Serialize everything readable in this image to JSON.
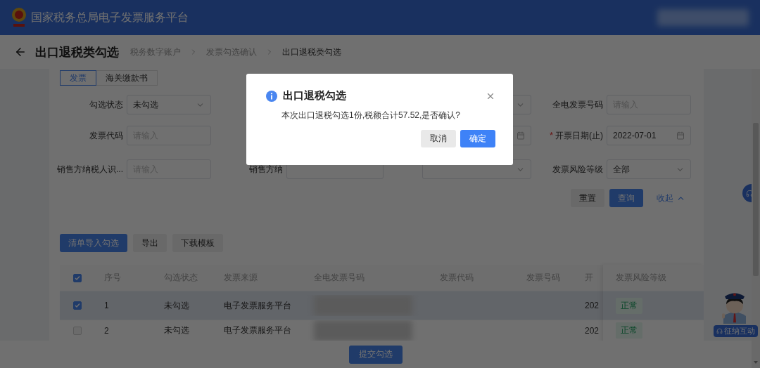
{
  "header": {
    "title": "国家税务总局电子发票服务平台"
  },
  "page": {
    "title": "出口退税类勾选",
    "breadcrumb": [
      {
        "label": "税务数字账户",
        "current": false
      },
      {
        "label": "发票勾选确认",
        "current": false
      },
      {
        "label": "出口退税类勾选",
        "current": true
      }
    ]
  },
  "tabs": [
    {
      "label": "发票",
      "selected": true
    },
    {
      "label": "海关缴款书",
      "selected": false
    }
  ],
  "filter_rows": [
    [
      {
        "kind": "select",
        "label": "勾选状态",
        "value": "未勾选"
      },
      {
        "kind": "blank"
      },
      {
        "kind": "select"
      },
      {
        "kind": "input",
        "label": "全电发票号码",
        "placeholder": "请输入"
      }
    ],
    [
      {
        "kind": "input",
        "label": "发票代码",
        "placeholder": "请输入"
      },
      {
        "kind": "blank"
      },
      {
        "kind": "date"
      },
      {
        "kind": "date",
        "label": "开票日期(止)",
        "required_mark": "*",
        "value": "2022-07-01"
      }
    ],
    [
      {
        "kind": "input",
        "label": "销售方纳税人识...",
        "placeholder": "请输入"
      },
      {
        "kind": "input",
        "label": "销售方纳"
      },
      {
        "kind": "select"
      },
      {
        "kind": "select",
        "label": "发票风险等级",
        "value": "全部"
      }
    ]
  ],
  "filter_actions": [
    {
      "label": "重置",
      "kind": "default"
    },
    {
      "label": "查询",
      "kind": "primary"
    },
    {
      "label": "收起",
      "kind": "link"
    }
  ],
  "toolbar": [
    {
      "label": "清单导入勾选",
      "kind": "primary"
    },
    {
      "label": "导出",
      "kind": "default"
    },
    {
      "label": "下载模板",
      "kind": "default"
    }
  ],
  "table": {
    "all_checked": true,
    "columns": [
      "序号",
      "勾选状态",
      "发票来源",
      "全电发票号码",
      "发票代码",
      "发票号码",
      "开",
      "发票风险等级"
    ],
    "rows": [
      {
        "checked": true,
        "selected": true,
        "cells": [
          "1",
          "未勾选",
          "电子发票服务平台",
          "",
          "",
          "",
          "202"
        ],
        "risk": "正常"
      },
      {
        "checked": false,
        "selected": false,
        "cells": [
          "2",
          "未勾选",
          "电子发票服务平台",
          "",
          "",
          "",
          "202"
        ],
        "risk": "正常"
      }
    ]
  },
  "footer": {
    "submit": "提交勾选"
  },
  "assistant": {
    "label": "征纳互动"
  },
  "dialog": {
    "title": "出口退税勾选",
    "message": "本次出口退税勾选1份,税额合计57.52,是否确认?",
    "buttons": [
      {
        "label": "取消",
        "kind": "default"
      },
      {
        "label": "确定",
        "kind": "primary"
      }
    ]
  }
}
